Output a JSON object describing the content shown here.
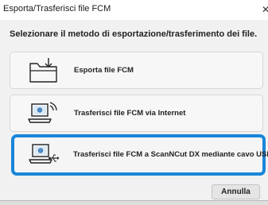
{
  "window": {
    "title": "Esporta/Trasferisci file FCM",
    "close_glyph": "✕"
  },
  "instruction": "Selezionare il metodo di esportazione/trasferimento dei file.",
  "options": [
    {
      "label": "Esporta file FCM",
      "icon": "folder-export-icon"
    },
    {
      "label": "Trasferisci file FCM via Internet",
      "icon": "laptop-wireless-icon"
    },
    {
      "label": "Trasferisci file FCM a ScanNCut DX mediante cavo USB",
      "icon": "laptop-usb-icon",
      "highlighted": true
    }
  ],
  "buttons": {
    "cancel": "Annulla"
  },
  "colors": {
    "accent": "#1a86d9",
    "icon_stroke": "#222222"
  }
}
